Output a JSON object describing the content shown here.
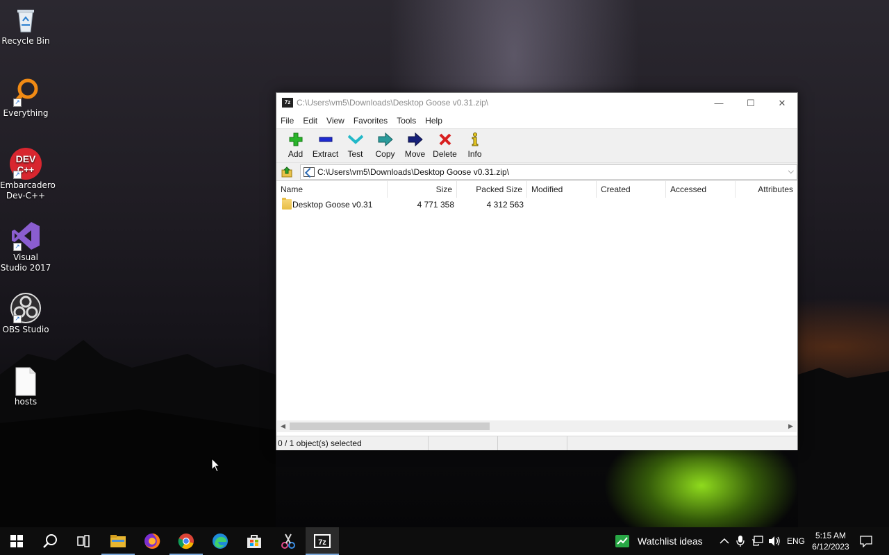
{
  "desktop": {
    "icons": [
      {
        "label": "Recycle Bin",
        "icon": "recycle-bin-icon"
      },
      {
        "label": "Everything",
        "icon": "everything-icon"
      },
      {
        "label": "Embarcadero Dev-C++",
        "icon": "dev-cpp-icon",
        "badge": "DEV C++"
      },
      {
        "label": "Visual Studio 2017",
        "icon": "visual-studio-icon"
      },
      {
        "label": "OBS Studio",
        "icon": "obs-icon"
      },
      {
        "label": "hosts",
        "icon": "file-icon"
      }
    ]
  },
  "window": {
    "app_icon_text": "7z",
    "title": "C:\\Users\\vm5\\Downloads\\Desktop Goose v0.31.zip\\",
    "controls": {
      "minimize": "—",
      "maximize": "☐",
      "close": "✕"
    },
    "menu": [
      "File",
      "Edit",
      "View",
      "Favorites",
      "Tools",
      "Help"
    ],
    "toolbar": [
      {
        "label": "Add",
        "icon": "add-icon"
      },
      {
        "label": "Extract",
        "icon": "extract-icon"
      },
      {
        "label": "Test",
        "icon": "test-icon"
      },
      {
        "label": "Copy",
        "icon": "copy-icon"
      },
      {
        "label": "Move",
        "icon": "move-icon"
      },
      {
        "label": "Delete",
        "icon": "delete-icon"
      },
      {
        "label": "Info",
        "icon": "info-icon"
      }
    ],
    "address": "C:\\Users\\vm5\\Downloads\\Desktop Goose v0.31.zip\\",
    "columns": [
      "Name",
      "Size",
      "Packed Size",
      "Modified",
      "Created",
      "Accessed",
      "Attributes"
    ],
    "rows": [
      {
        "name": "Desktop Goose v0.31",
        "size": "4 771 358",
        "packed": "4 312 563",
        "modified": "",
        "created": "",
        "accessed": "",
        "attributes": ""
      }
    ],
    "status": "0 / 1 object(s) selected"
  },
  "taskbar": {
    "apps": [
      "start-icon",
      "search-icon",
      "task-view-icon",
      "file-explorer-icon",
      "firefox-icon",
      "chrome-icon",
      "edge-icon",
      "store-icon",
      "snipping-icon",
      "7zip-icon"
    ],
    "widget_label": "Watchlist ideas",
    "language": "ENG",
    "time": "5:15 AM",
    "date": "6/12/2023"
  }
}
